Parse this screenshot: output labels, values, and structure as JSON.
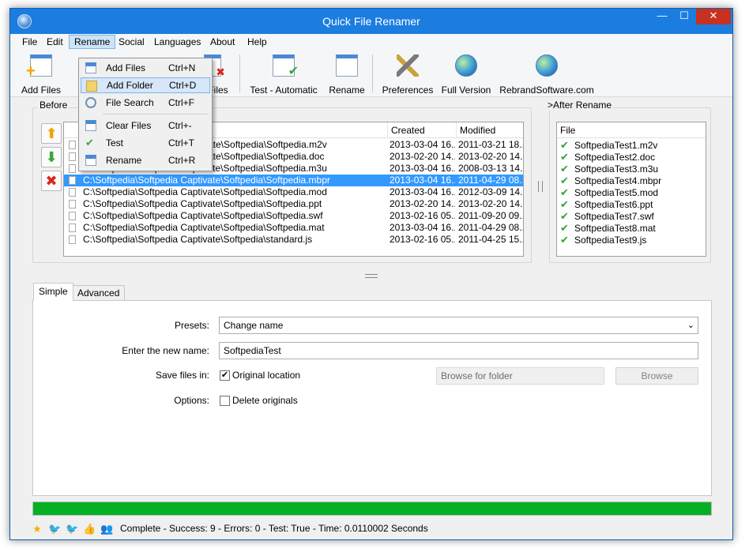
{
  "window": {
    "title": "Quick File Renamer"
  },
  "menubar": {
    "items": [
      "File",
      "Edit",
      "Rename",
      "Social",
      "Languages",
      "About",
      "Help"
    ]
  },
  "toolbar": {
    "add_files": "Add Files",
    "clear_files": "ar Files",
    "test_automatic": "Test - Automatic",
    "rename": "Rename",
    "preferences": "Preferences",
    "full_version": "Full Version",
    "rebrand": "RebrandSoftware.com"
  },
  "dropdown": {
    "items": [
      {
        "label": "Add Files",
        "shortcut": "Ctrl+N"
      },
      {
        "label": "Add Folder",
        "shortcut": "Ctrl+D"
      },
      {
        "label": "File Search",
        "shortcut": "Ctrl+F"
      },
      {
        "label": "Clear Files",
        "shortcut": "Ctrl+-"
      },
      {
        "label": "Test",
        "shortcut": "Ctrl+T"
      },
      {
        "label": "Rename",
        "shortcut": "Ctrl+R"
      }
    ]
  },
  "before": {
    "label": "Before",
    "columns": {
      "created": "Created",
      "modified": "Modified"
    },
    "rows": [
      {
        "path": "vate\\Softpedia\\Softpedia.m2v",
        "created": "2013-03-04 16...",
        "modified": "2011-03-21 18..."
      },
      {
        "path": "vate\\Softpedia\\Softpedia.doc",
        "created": "2013-02-20 14...",
        "modified": "2013-02-20 14..."
      },
      {
        "path": "C:\\Softpedia\\Softpedia Captivate\\Softpedia\\Softpedia.m3u",
        "created": "2013-03-04 16...",
        "modified": "2008-03-13 14..."
      },
      {
        "path": "C:\\Softpedia\\Softpedia Captivate\\Softpedia\\Softpedia.mbpr",
        "created": "2013-03-04 16...",
        "modified": "2011-04-29 08..."
      },
      {
        "path": "C:\\Softpedia\\Softpedia Captivate\\Softpedia\\Softpedia.mod",
        "created": "2013-03-04 16...",
        "modified": "2012-03-09 14..."
      },
      {
        "path": "C:\\Softpedia\\Softpedia Captivate\\Softpedia\\Softpedia.ppt",
        "created": "2013-02-20 14...",
        "modified": "2013-02-20 14..."
      },
      {
        "path": "C:\\Softpedia\\Softpedia Captivate\\Softpedia\\Softpedia.swf",
        "created": "2013-02-16 05...",
        "modified": "2011-09-20 09..."
      },
      {
        "path": "C:\\Softpedia\\Softpedia Captivate\\Softpedia\\Softpedia.mat",
        "created": "2013-03-04 16...",
        "modified": "2011-04-29 08..."
      },
      {
        "path": "C:\\Softpedia\\Softpedia Captivate\\Softpedia\\standard.js",
        "created": "2013-02-16 05...",
        "modified": "2011-04-25 15..."
      }
    ]
  },
  "after": {
    "label": "After Rename",
    "column": "File",
    "rows": [
      "SoftpediaTest1.m2v",
      "SoftpediaTest2.doc",
      "SoftpediaTest3.m3u",
      "SoftpediaTest4.mbpr",
      "SoftpediaTest5.mod",
      "SoftpediaTest6.ppt",
      "SoftpediaTest7.swf",
      "SoftpediaTest8.mat",
      "SoftpediaTest9.js"
    ]
  },
  "tabs": {
    "simple": "Simple",
    "advanced": "Advanced"
  },
  "form": {
    "presets_label": "Presets:",
    "presets_value": "Change name",
    "new_name_label": "Enter the new name:",
    "new_name_value": "SoftpediaTest",
    "save_label": "Save files in:",
    "original_location": "Original location",
    "browse_placeholder": "Browse for folder",
    "browse_button": "Browse",
    "options_label": "Options:",
    "delete_originals": "Delete originals"
  },
  "progress": {
    "percent": 100
  },
  "status": {
    "text": "Complete - Success: 9 - Errors: 0 - Test: True - Time: 0.0110002 Seconds"
  },
  "colors": {
    "title_bar": "#1b7de0",
    "progress": "#06b025",
    "selection": "#3399ff"
  }
}
